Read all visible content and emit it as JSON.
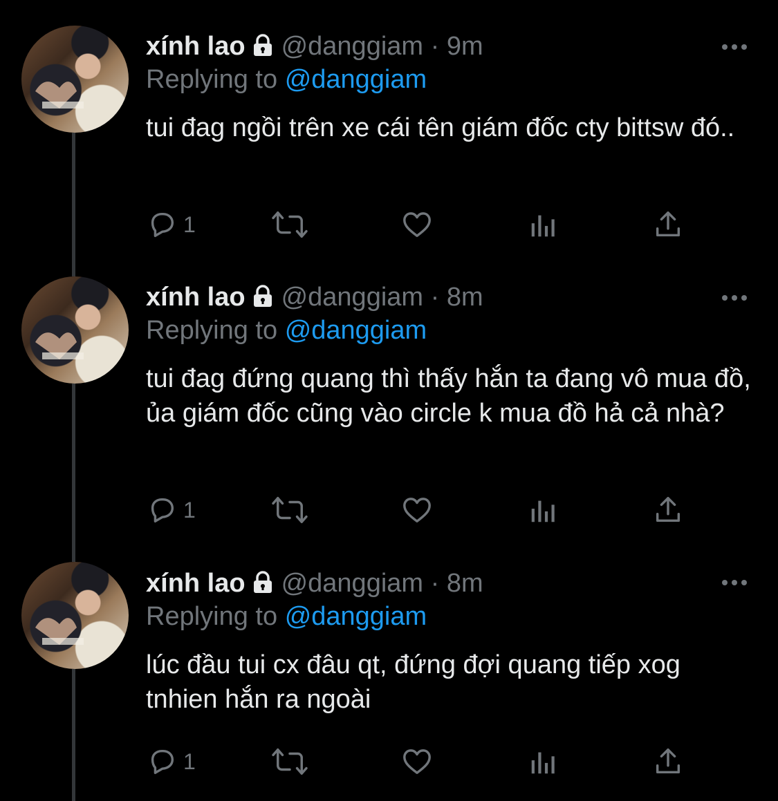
{
  "tweets": [
    {
      "name": "xính lao",
      "handle": "@danggiam",
      "time": "9m",
      "replying_prefix": "Replying to",
      "replying_to": "@danggiam",
      "text": "tui đag ngồi trên xe cái tên giám đốc cty bittsw đó..",
      "reply_count": "1"
    },
    {
      "name": "xính lao",
      "handle": "@danggiam",
      "time": "8m",
      "replying_prefix": "Replying to",
      "replying_to": "@danggiam",
      "text": "tui đag đứng quang thì thấy hắn ta đang vô mua đồ, ủa giám đốc cũng vào circle k mua đồ hả cả nhà?",
      "reply_count": "1"
    },
    {
      "name": "xính lao",
      "handle": "@danggiam",
      "time": "8m",
      "replying_prefix": "Replying to",
      "replying_to": "@danggiam",
      "text": "lúc đầu tui cx đâu qt, đứng đợi quang tiếp xog tnhien hắn ra ngoài",
      "reply_count": "1"
    }
  ],
  "separator": "·",
  "icons": {
    "lock": "lock-icon",
    "more": "more-icon",
    "reply": "reply-icon",
    "retweet": "retweet-icon",
    "like": "like-icon",
    "views": "views-icon",
    "share": "share-icon"
  },
  "colors": {
    "background": "#000000",
    "text": "#e7e9ea",
    "secondary": "#71767b",
    "accent": "#1d9bf0",
    "thread_line": "#333639"
  }
}
